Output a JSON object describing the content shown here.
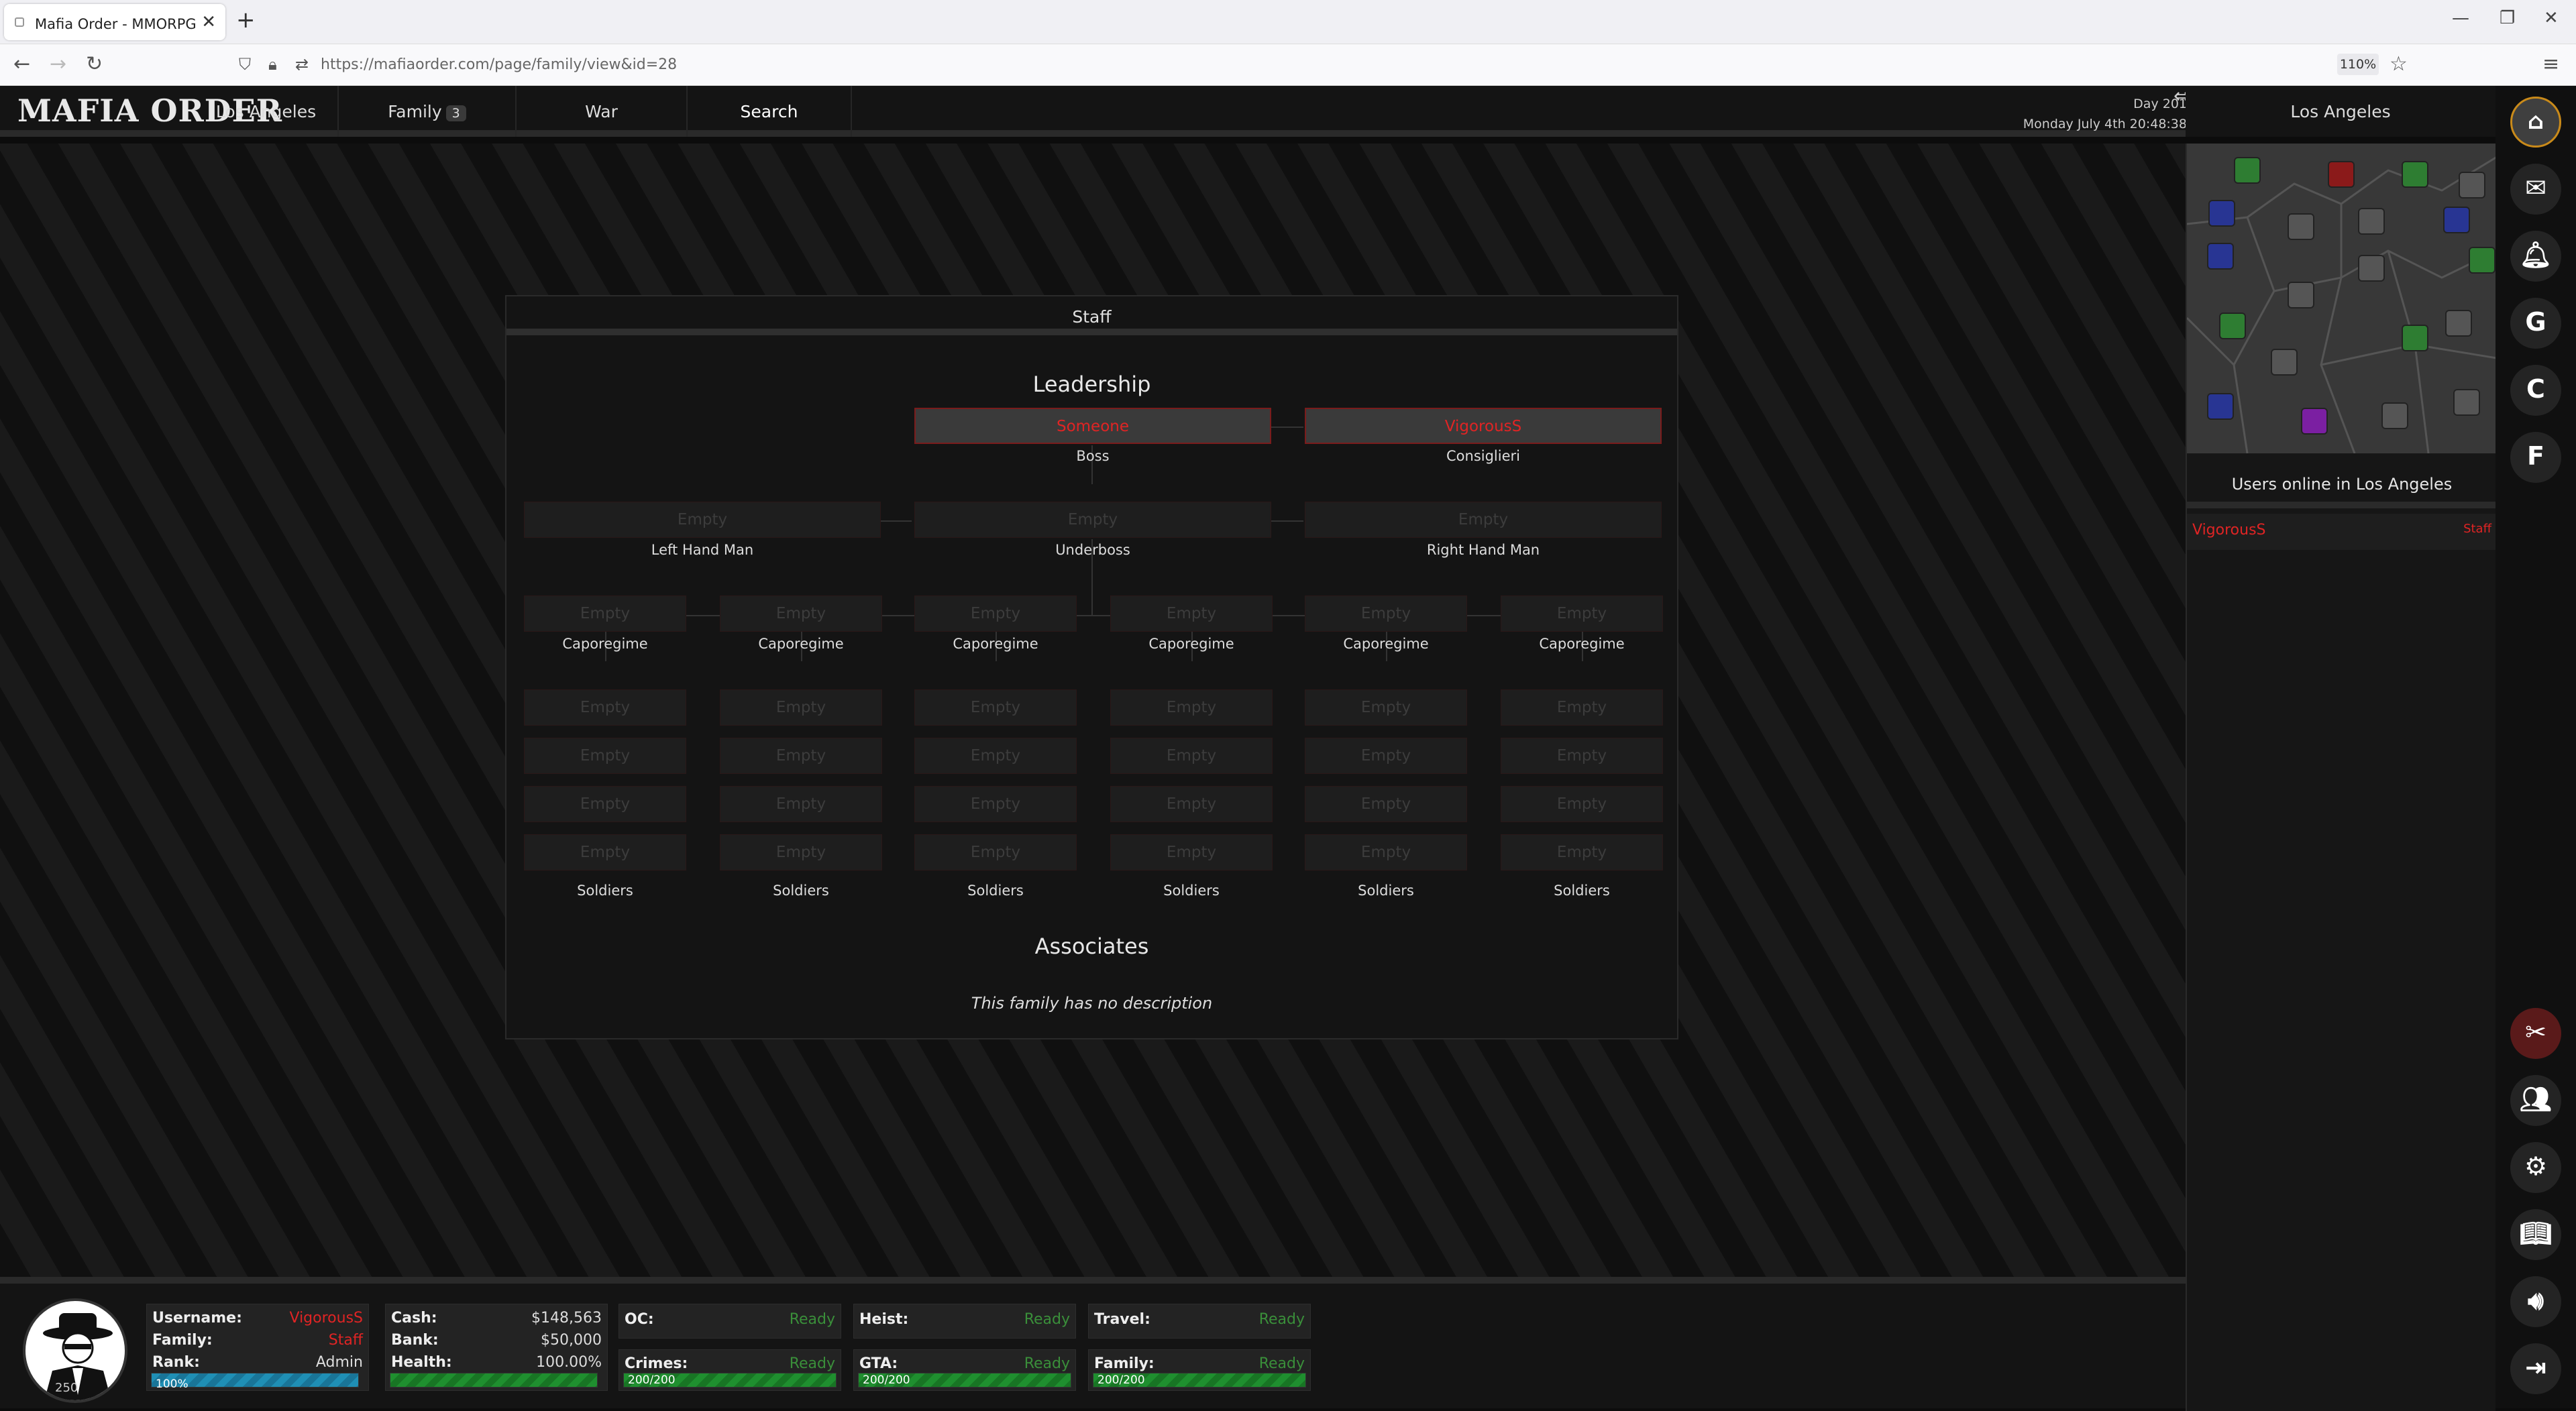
{
  "browser": {
    "tab_title": "Mafia Order - MMORPG",
    "url": "https://mafiaorder.com/page/family/view&id=28",
    "zoom": "110%"
  },
  "header": {
    "logo": "MAFIA ORDER",
    "nav": [
      {
        "label": "Los Angeles"
      },
      {
        "label": "Family",
        "badge": "3"
      },
      {
        "label": "War"
      },
      {
        "label": "Search"
      }
    ],
    "day": "Day 201",
    "datetime": "Monday July 4th 20:48:38",
    "city": "Los Angeles"
  },
  "panel": {
    "title": "Staff",
    "leadership_heading": "Leadership",
    "associates_heading": "Associates",
    "no_description": "This family has no description",
    "boss": {
      "name": "Someone",
      "role": "Boss"
    },
    "consigliere": {
      "name": "VigorousS",
      "role": "Consiglieri"
    },
    "left_hand": {
      "name": "Empty",
      "role": "Left Hand Man"
    },
    "underboss": {
      "name": "Empty",
      "role": "Underboss"
    },
    "right_hand": {
      "name": "Empty",
      "role": "Right Hand Man"
    },
    "empty_label": "Empty",
    "capo_role": "Caporegime",
    "soldiers_role": "Soldiers"
  },
  "sidebar": {
    "users_online_title": "Users online in Los Angeles",
    "online_users": [
      {
        "name": "VigorousS",
        "rank": "Staff"
      }
    ]
  },
  "player": {
    "username_label": "Username:",
    "username": "VigorousS",
    "family_label": "Family:",
    "family": "Staff",
    "rank_label": "Rank:",
    "rank": "Admin",
    "rank_progress": "100%",
    "coins": "250",
    "cash_label": "Cash:",
    "cash": "$148,563",
    "bank_label": "Bank:",
    "bank": "$50,000",
    "health_label": "Health:",
    "health": "100.00%"
  },
  "timers": {
    "oc_label": "OC:",
    "oc": "Ready",
    "heist_label": "Heist:",
    "heist": "Ready",
    "travel_label": "Travel:",
    "travel": "Ready",
    "crimes_label": "Crimes:",
    "crimes": "Ready",
    "crimes_bar": "200/200",
    "gta_label": "GTA:",
    "gta": "Ready",
    "gta_bar": "200/200",
    "family_label": "Family:",
    "family": "Ready",
    "family_bar": "200/200"
  },
  "colors": {
    "accent_red": "#e02424",
    "ready_green": "#3a8f3a",
    "bar_blue": "#1f8fb5",
    "bar_green": "#1f8f2f"
  },
  "icons": {
    "strip": [
      "city-map-icon",
      "mail-icon",
      "bell-icon",
      "g-icon",
      "c-icon",
      "f-icon",
      "admin-tools-icon",
      "users-icon",
      "gear-icon",
      "book-icon",
      "speaker-icon",
      "logout-icon"
    ]
  }
}
